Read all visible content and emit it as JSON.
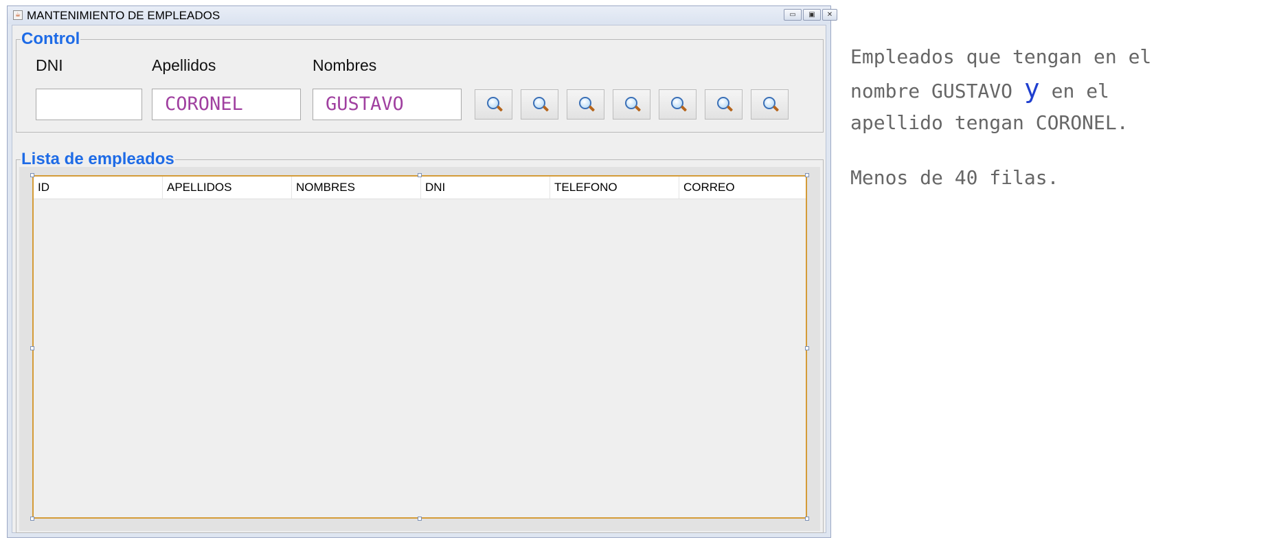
{
  "window": {
    "title": "MANTENIMIENTO DE EMPLEADOS",
    "controls": {
      "minimize": "▭",
      "maximize": "▣",
      "close": "✕"
    }
  },
  "control": {
    "legend": "Control",
    "labels": {
      "dni": "DNI",
      "apellidos": "Apellidos",
      "nombres": "Nombres"
    },
    "fields": {
      "dni": "",
      "apellidos": "CORONEL",
      "nombres": "GUSTAVO"
    },
    "search_buttons_count_icon": "search-icon"
  },
  "list": {
    "legend": "Lista de empleados",
    "columns": [
      "ID",
      "APELLIDOS",
      "NOMBRES",
      "DNI",
      "TELEFONO",
      "CORREO"
    ],
    "rows": []
  },
  "note": {
    "line1": "Empleados que tengan en el",
    "line2_a": "nombre GUSTAVO ",
    "line2_y": "y",
    "line2_b": " en el",
    "line3": "apellido tengan CORONEL.",
    "line4": "Menos de 40 filas."
  },
  "colors": {
    "legend": "#1e6be6",
    "field_text": "#a040a0",
    "table_border": "#d49b37",
    "note_text": "#666666",
    "note_emphasis": "#1f3fcf"
  }
}
